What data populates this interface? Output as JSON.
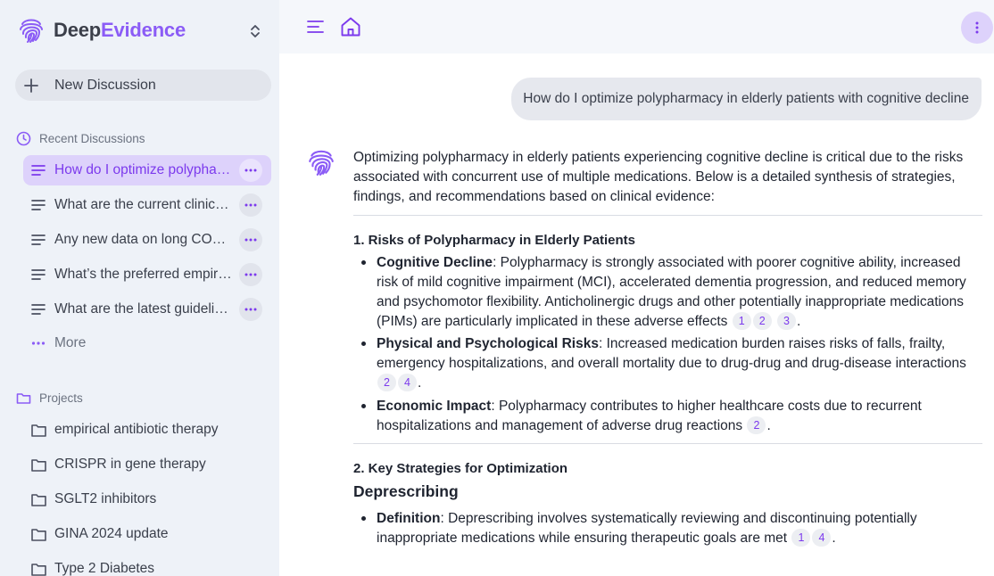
{
  "brand": {
    "name_a": "Deep",
    "name_b": "Evidence",
    "accent_color": "#8b5cf6"
  },
  "sidebar": {
    "new_discussion": "New Discussion",
    "recent_heading": "Recent Discussions",
    "discussions": [
      {
        "title": "How do I optimize polypharmacy in elderly patients with cognitive decline",
        "active": true
      },
      {
        "title": "What are the current clinical guidelines",
        "active": false
      },
      {
        "title": "Any new data on long COVID",
        "active": false
      },
      {
        "title": "What’s the preferred empirical antibiotic therapy",
        "active": false
      },
      {
        "title": "What are the latest guidelines",
        "active": false
      }
    ],
    "more": "More",
    "projects_heading": "Projects",
    "projects": [
      "empirical antibiotic therapy",
      "CRISPR in gene therapy",
      "SGLT2 inhibitors",
      "GINA 2024 update",
      "Type 2 Diabetes"
    ]
  },
  "chat": {
    "user_message": "How do I optimize polypharmacy in elderly patients with cognitive decline",
    "answer": {
      "intro": "Optimizing polypharmacy in elderly patients experiencing cognitive decline is critical due to the risks associated with concurrent use of multiple medications. Below is a detailed synthesis of strategies, findings, and recommendations based on clinical evidence:",
      "section1_title": "1. Risks of Polypharmacy in Elderly Patients",
      "section1_items": [
        {
          "term": "Cognitive Decline",
          "text": ": Polypharmacy is strongly associated with poorer cognitive ability, increased risk of mild cognitive impairment (MCI), accelerated dementia progression, and reduced memory and psychomotor flexibility. Anticholinergic drugs and other potentially inappropriate medications (PIMs) are particularly implicated in these adverse effects",
          "cites": [
            "1",
            "2",
            "3"
          ]
        },
        {
          "term": "Physical and Psychological Risks",
          "text": ": Increased medication burden raises risks of falls, frailty, emergency hospitalizations, and overall mortality due to drug-drug and drug-disease interactions",
          "cites": [
            "2",
            "4"
          ]
        },
        {
          "term": "Economic Impact",
          "text": ": Polypharmacy contributes to higher healthcare costs due to recurrent hospitalizations and management of adverse drug reactions",
          "cites": [
            "2"
          ]
        }
      ],
      "section2_title": "2. Key Strategies for Optimization",
      "subsection_title": "Deprescribing",
      "section2_items": [
        {
          "term": "Definition",
          "text": ": Deprescribing involves systematically reviewing and discontinuing potentially inappropriate medications while ensuring therapeutic goals are met",
          "cites": [
            "1",
            "4"
          ]
        }
      ]
    }
  }
}
